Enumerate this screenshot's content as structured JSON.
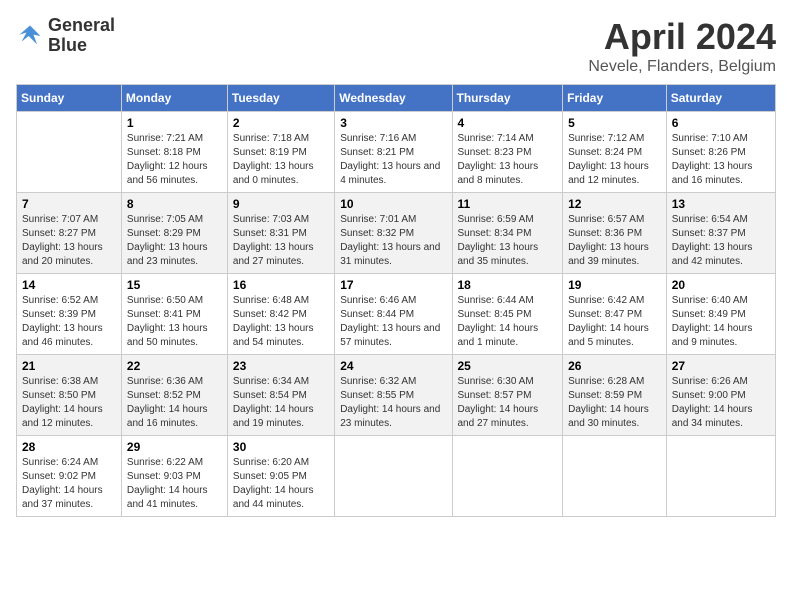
{
  "logo": {
    "line1": "General",
    "line2": "Blue"
  },
  "title": "April 2024",
  "location": "Nevele, Flanders, Belgium",
  "days_header": [
    "Sunday",
    "Monday",
    "Tuesday",
    "Wednesday",
    "Thursday",
    "Friday",
    "Saturday"
  ],
  "weeks": [
    [
      {
        "day": "",
        "sunrise": "",
        "sunset": "",
        "daylight": ""
      },
      {
        "day": "1",
        "sunrise": "Sunrise: 7:21 AM",
        "sunset": "Sunset: 8:18 PM",
        "daylight": "Daylight: 12 hours and 56 minutes."
      },
      {
        "day": "2",
        "sunrise": "Sunrise: 7:18 AM",
        "sunset": "Sunset: 8:19 PM",
        "daylight": "Daylight: 13 hours and 0 minutes."
      },
      {
        "day": "3",
        "sunrise": "Sunrise: 7:16 AM",
        "sunset": "Sunset: 8:21 PM",
        "daylight": "Daylight: 13 hours and 4 minutes."
      },
      {
        "day": "4",
        "sunrise": "Sunrise: 7:14 AM",
        "sunset": "Sunset: 8:23 PM",
        "daylight": "Daylight: 13 hours and 8 minutes."
      },
      {
        "day": "5",
        "sunrise": "Sunrise: 7:12 AM",
        "sunset": "Sunset: 8:24 PM",
        "daylight": "Daylight: 13 hours and 12 minutes."
      },
      {
        "day": "6",
        "sunrise": "Sunrise: 7:10 AM",
        "sunset": "Sunset: 8:26 PM",
        "daylight": "Daylight: 13 hours and 16 minutes."
      }
    ],
    [
      {
        "day": "7",
        "sunrise": "Sunrise: 7:07 AM",
        "sunset": "Sunset: 8:27 PM",
        "daylight": "Daylight: 13 hours and 20 minutes."
      },
      {
        "day": "8",
        "sunrise": "Sunrise: 7:05 AM",
        "sunset": "Sunset: 8:29 PM",
        "daylight": "Daylight: 13 hours and 23 minutes."
      },
      {
        "day": "9",
        "sunrise": "Sunrise: 7:03 AM",
        "sunset": "Sunset: 8:31 PM",
        "daylight": "Daylight: 13 hours and 27 minutes."
      },
      {
        "day": "10",
        "sunrise": "Sunrise: 7:01 AM",
        "sunset": "Sunset: 8:32 PM",
        "daylight": "Daylight: 13 hours and 31 minutes."
      },
      {
        "day": "11",
        "sunrise": "Sunrise: 6:59 AM",
        "sunset": "Sunset: 8:34 PM",
        "daylight": "Daylight: 13 hours and 35 minutes."
      },
      {
        "day": "12",
        "sunrise": "Sunrise: 6:57 AM",
        "sunset": "Sunset: 8:36 PM",
        "daylight": "Daylight: 13 hours and 39 minutes."
      },
      {
        "day": "13",
        "sunrise": "Sunrise: 6:54 AM",
        "sunset": "Sunset: 8:37 PM",
        "daylight": "Daylight: 13 hours and 42 minutes."
      }
    ],
    [
      {
        "day": "14",
        "sunrise": "Sunrise: 6:52 AM",
        "sunset": "Sunset: 8:39 PM",
        "daylight": "Daylight: 13 hours and 46 minutes."
      },
      {
        "day": "15",
        "sunrise": "Sunrise: 6:50 AM",
        "sunset": "Sunset: 8:41 PM",
        "daylight": "Daylight: 13 hours and 50 minutes."
      },
      {
        "day": "16",
        "sunrise": "Sunrise: 6:48 AM",
        "sunset": "Sunset: 8:42 PM",
        "daylight": "Daylight: 13 hours and 54 minutes."
      },
      {
        "day": "17",
        "sunrise": "Sunrise: 6:46 AM",
        "sunset": "Sunset: 8:44 PM",
        "daylight": "Daylight: 13 hours and 57 minutes."
      },
      {
        "day": "18",
        "sunrise": "Sunrise: 6:44 AM",
        "sunset": "Sunset: 8:45 PM",
        "daylight": "Daylight: 14 hours and 1 minute."
      },
      {
        "day": "19",
        "sunrise": "Sunrise: 6:42 AM",
        "sunset": "Sunset: 8:47 PM",
        "daylight": "Daylight: 14 hours and 5 minutes."
      },
      {
        "day": "20",
        "sunrise": "Sunrise: 6:40 AM",
        "sunset": "Sunset: 8:49 PM",
        "daylight": "Daylight: 14 hours and 9 minutes."
      }
    ],
    [
      {
        "day": "21",
        "sunrise": "Sunrise: 6:38 AM",
        "sunset": "Sunset: 8:50 PM",
        "daylight": "Daylight: 14 hours and 12 minutes."
      },
      {
        "day": "22",
        "sunrise": "Sunrise: 6:36 AM",
        "sunset": "Sunset: 8:52 PM",
        "daylight": "Daylight: 14 hours and 16 minutes."
      },
      {
        "day": "23",
        "sunrise": "Sunrise: 6:34 AM",
        "sunset": "Sunset: 8:54 PM",
        "daylight": "Daylight: 14 hours and 19 minutes."
      },
      {
        "day": "24",
        "sunrise": "Sunrise: 6:32 AM",
        "sunset": "Sunset: 8:55 PM",
        "daylight": "Daylight: 14 hours and 23 minutes."
      },
      {
        "day": "25",
        "sunrise": "Sunrise: 6:30 AM",
        "sunset": "Sunset: 8:57 PM",
        "daylight": "Daylight: 14 hours and 27 minutes."
      },
      {
        "day": "26",
        "sunrise": "Sunrise: 6:28 AM",
        "sunset": "Sunset: 8:59 PM",
        "daylight": "Daylight: 14 hours and 30 minutes."
      },
      {
        "day": "27",
        "sunrise": "Sunrise: 6:26 AM",
        "sunset": "Sunset: 9:00 PM",
        "daylight": "Daylight: 14 hours and 34 minutes."
      }
    ],
    [
      {
        "day": "28",
        "sunrise": "Sunrise: 6:24 AM",
        "sunset": "Sunset: 9:02 PM",
        "daylight": "Daylight: 14 hours and 37 minutes."
      },
      {
        "day": "29",
        "sunrise": "Sunrise: 6:22 AM",
        "sunset": "Sunset: 9:03 PM",
        "daylight": "Daylight: 14 hours and 41 minutes."
      },
      {
        "day": "30",
        "sunrise": "Sunrise: 6:20 AM",
        "sunset": "Sunset: 9:05 PM",
        "daylight": "Daylight: 14 hours and 44 minutes."
      },
      {
        "day": "",
        "sunrise": "",
        "sunset": "",
        "daylight": ""
      },
      {
        "day": "",
        "sunrise": "",
        "sunset": "",
        "daylight": ""
      },
      {
        "day": "",
        "sunrise": "",
        "sunset": "",
        "daylight": ""
      },
      {
        "day": "",
        "sunrise": "",
        "sunset": "",
        "daylight": ""
      }
    ]
  ]
}
